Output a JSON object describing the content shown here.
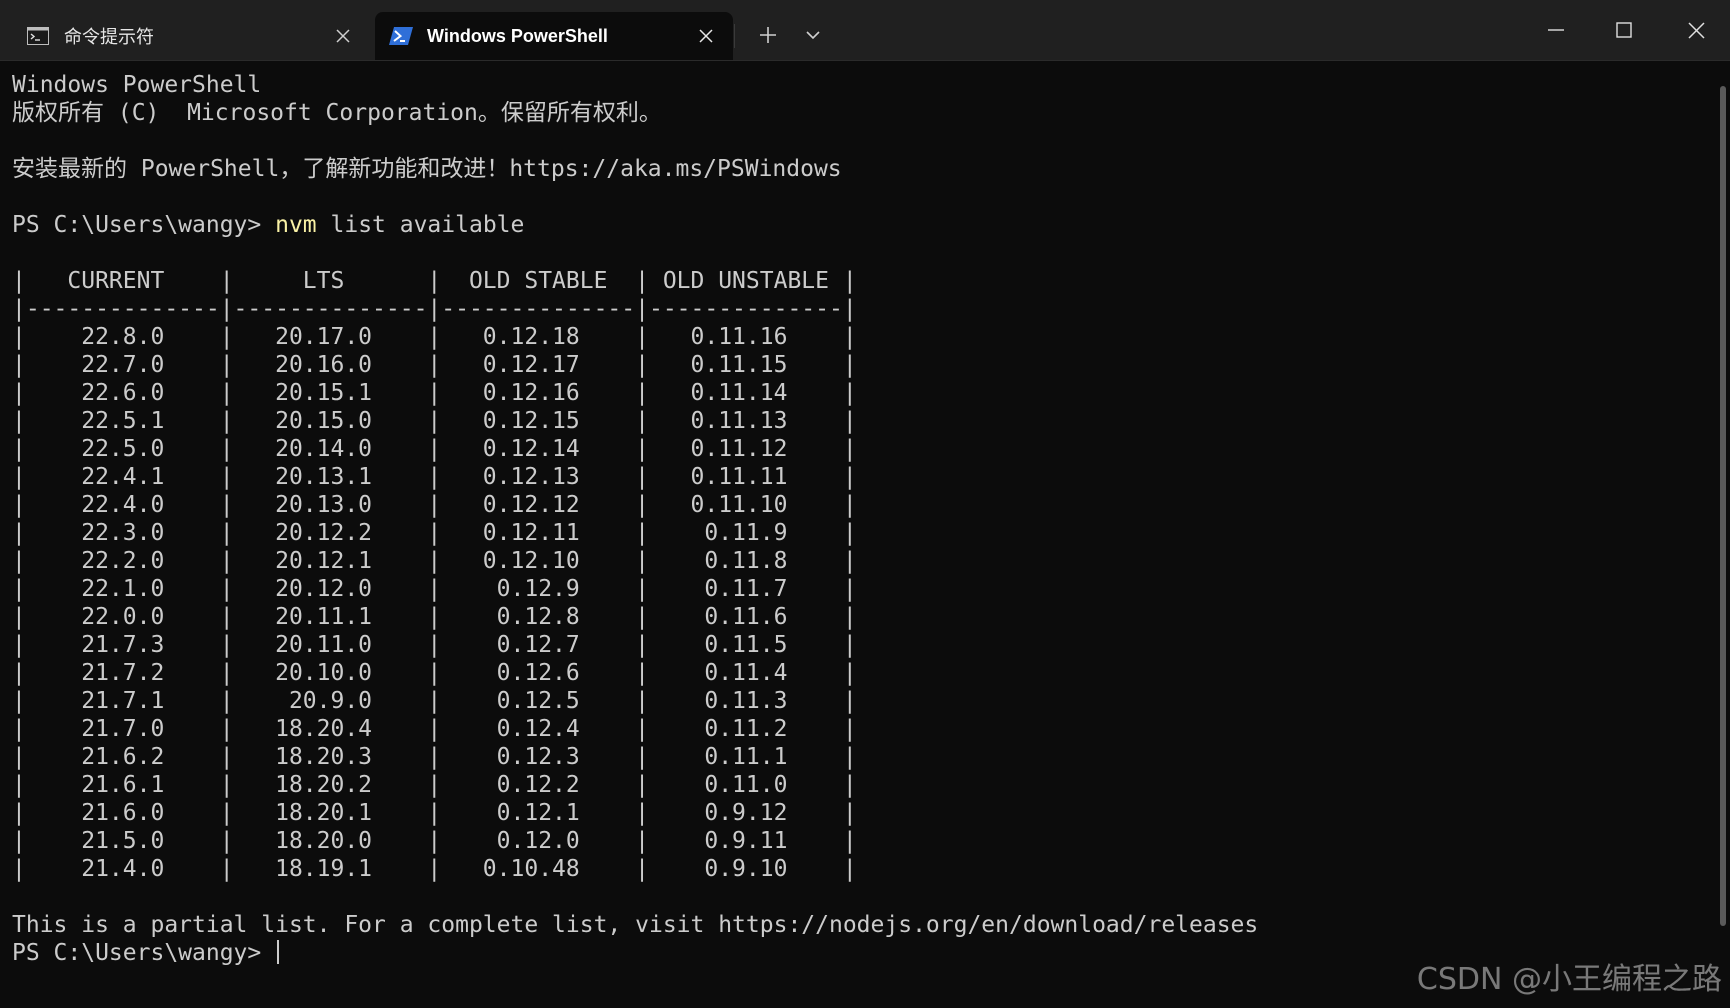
{
  "tabs": [
    {
      "title": "命令提示符",
      "icon": "cmd-terminal-icon",
      "active": false
    },
    {
      "title": "Windows PowerShell",
      "icon": "powershell-icon",
      "active": true
    }
  ],
  "colors": {
    "background": "#0c0c0c",
    "text": "#cccccc",
    "command": "#f9f1a5",
    "titlebar": "#202020",
    "powershell_icon": "#2f6fd8"
  },
  "terminal": {
    "banner": [
      "Windows PowerShell",
      "版权所有 (C)  Microsoft Corporation。保留所有权利。"
    ],
    "install_hint": "安装最新的 PowerShell，了解新功能和改进！https://aka.ms/PSWindows",
    "prompt": "PS C:\\Users\\wangy> ",
    "command_name": "nvm",
    "command_args": " list available",
    "table": {
      "columns": [
        "CURRENT",
        "LTS",
        "OLD STABLE",
        "OLD UNSTABLE"
      ],
      "rows": [
        [
          "22.8.0",
          "20.17.0",
          "0.12.18",
          "0.11.16"
        ],
        [
          "22.7.0",
          "20.16.0",
          "0.12.17",
          "0.11.15"
        ],
        [
          "22.6.0",
          "20.15.1",
          "0.12.16",
          "0.11.14"
        ],
        [
          "22.5.1",
          "20.15.0",
          "0.12.15",
          "0.11.13"
        ],
        [
          "22.5.0",
          "20.14.0",
          "0.12.14",
          "0.11.12"
        ],
        [
          "22.4.1",
          "20.13.1",
          "0.12.13",
          "0.11.11"
        ],
        [
          "22.4.0",
          "20.13.0",
          "0.12.12",
          "0.11.10"
        ],
        [
          "22.3.0",
          "20.12.2",
          "0.12.11",
          "0.11.9"
        ],
        [
          "22.2.0",
          "20.12.1",
          "0.12.10",
          "0.11.8"
        ],
        [
          "22.1.0",
          "20.12.0",
          "0.12.9",
          "0.11.7"
        ],
        [
          "22.0.0",
          "20.11.1",
          "0.12.8",
          "0.11.6"
        ],
        [
          "21.7.3",
          "20.11.0",
          "0.12.7",
          "0.11.5"
        ],
        [
          "21.7.2",
          "20.10.0",
          "0.12.6",
          "0.11.4"
        ],
        [
          "21.7.1",
          "20.9.0",
          "0.12.5",
          "0.11.3"
        ],
        [
          "21.7.0",
          "18.20.4",
          "0.12.4",
          "0.11.2"
        ],
        [
          "21.6.2",
          "18.20.3",
          "0.12.3",
          "0.11.1"
        ],
        [
          "21.6.1",
          "18.20.2",
          "0.12.2",
          "0.11.0"
        ],
        [
          "21.6.0",
          "18.20.1",
          "0.12.1",
          "0.9.12"
        ],
        [
          "21.5.0",
          "18.20.0",
          "0.12.0",
          "0.9.11"
        ],
        [
          "21.4.0",
          "18.19.1",
          "0.10.48",
          "0.9.10"
        ]
      ]
    },
    "footer": "This is a partial list. For a complete list, visit https://nodejs.org/en/download/releases",
    "final_prompt": "PS C:\\Users\\wangy> "
  },
  "watermark": "CSDN @小王编程之路"
}
